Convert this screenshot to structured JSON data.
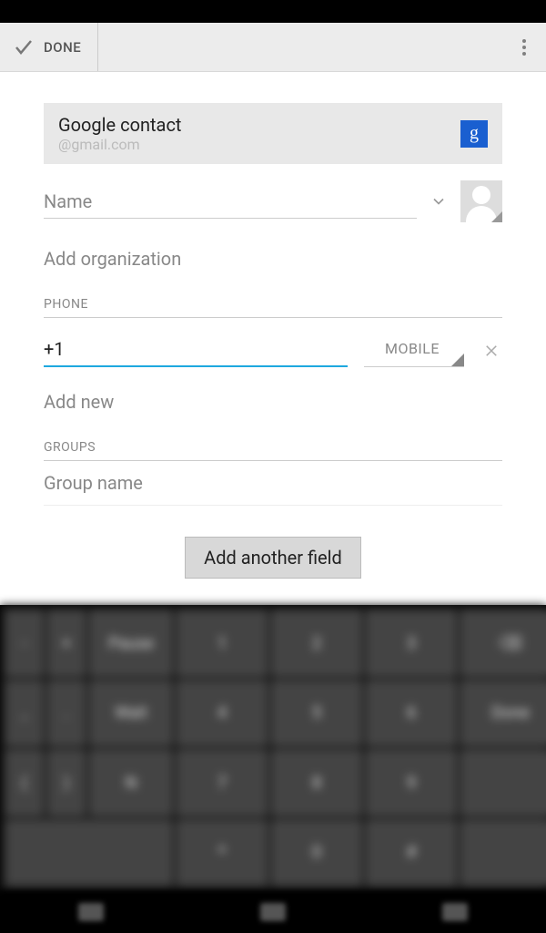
{
  "actionbar": {
    "done": "DONE"
  },
  "account": {
    "title": "Google contact",
    "email": "@gmail.com"
  },
  "name": {
    "placeholder": "Name"
  },
  "org": {
    "label": "Add organization"
  },
  "phone": {
    "section": "PHONE",
    "value": "+1",
    "type": "MOBILE",
    "add_new": "Add new"
  },
  "groups": {
    "section": "GROUPS",
    "placeholder": "Group name"
  },
  "add_field": "Add another field"
}
